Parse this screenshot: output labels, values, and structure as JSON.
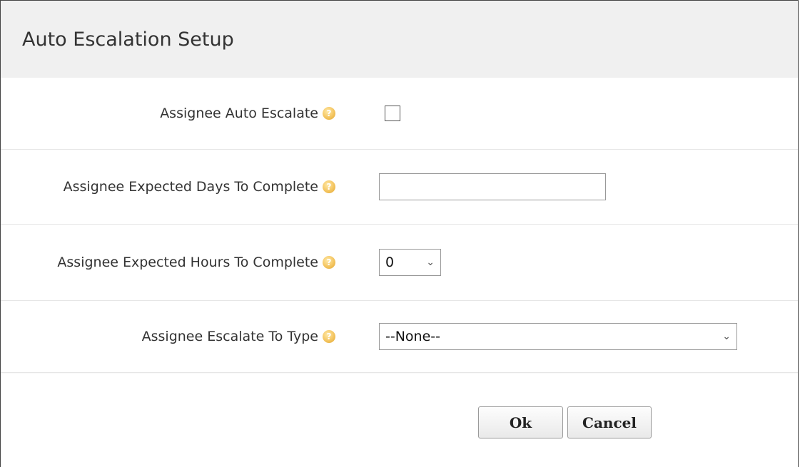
{
  "dialog": {
    "title": "Auto Escalation Setup"
  },
  "fields": {
    "auto_escalate": {
      "label": "Assignee Auto Escalate",
      "checked": false
    },
    "expected_days": {
      "label": "Assignee Expected Days To Complete",
      "value": ""
    },
    "expected_hours": {
      "label": "Assignee Expected Hours To Complete",
      "selected": "0"
    },
    "escalate_to_type": {
      "label": "Assignee Escalate To Type",
      "selected": "--None--"
    }
  },
  "icons": {
    "help": "help-icon",
    "dropdown": "chevron-down-icon"
  },
  "buttons": {
    "ok_label": "Ok",
    "cancel_label": "Cancel"
  },
  "colors": {
    "titlebar_bg": "#f0f0f0",
    "help_icon": "#f4c560"
  }
}
